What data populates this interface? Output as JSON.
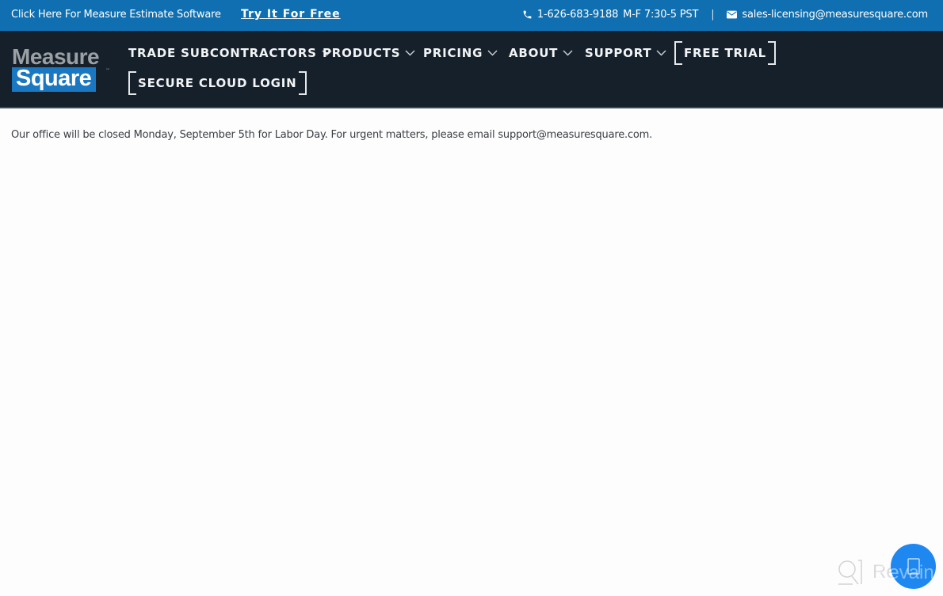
{
  "topbar": {
    "promo_text": "Click Here For Measure Estimate Software",
    "try_link": "Try It For Free",
    "phone": "1-626-683-9188",
    "hours": "M-F 7:30-5 PST",
    "separator": "|",
    "email": "sales-licensing@measuresquare.com",
    "icons": {
      "phone": "phone-icon",
      "email": "envelope-icon"
    }
  },
  "logo": {
    "line1": "Measure",
    "line2": "Square",
    "tm": "™"
  },
  "nav": {
    "items": [
      {
        "label": "TRADE SUBCONTRACTORS",
        "has_dropdown": true
      },
      {
        "label": "PRODUCTS",
        "has_dropdown": true
      },
      {
        "label": "PRICING",
        "has_dropdown": true
      },
      {
        "label": "ABOUT",
        "has_dropdown": true
      },
      {
        "label": "SUPPORT",
        "has_dropdown": true
      }
    ],
    "free_trial": "FREE TRIAL",
    "cloud_login": "SECURE CLOUD LOGIN"
  },
  "notice": "Our office will be closed Monday, September 5th for Labor Day. For urgent matters, please email support@measuresquare.com.",
  "watermark": {
    "text": "Revain"
  },
  "colors": {
    "topbar_bg": "#0f6fb0",
    "nav_bg": "#16202b",
    "logo_blue": "#1a78c2",
    "chat_button": "#1e88f0"
  }
}
